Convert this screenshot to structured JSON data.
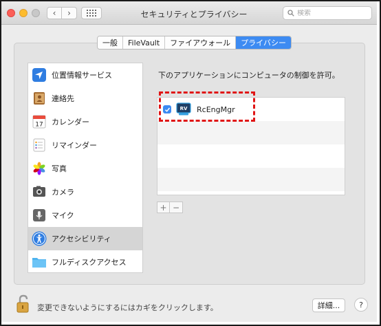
{
  "window": {
    "title": "セキュリティとプライバシー",
    "search_placeholder": "検索"
  },
  "tabs": [
    {
      "label": "一般",
      "active": false
    },
    {
      "label": "FileVault",
      "active": false
    },
    {
      "label": "ファイアウォール",
      "active": false
    },
    {
      "label": "プライバシー",
      "active": true
    }
  ],
  "sidebar": {
    "items": [
      {
        "label": "位置情報サービス",
        "icon": "location-arrow-icon"
      },
      {
        "label": "連絡先",
        "icon": "contacts-book-icon"
      },
      {
        "label": "カレンダー",
        "icon": "calendar-icon",
        "date": "17"
      },
      {
        "label": "リマインダー",
        "icon": "reminders-icon"
      },
      {
        "label": "写真",
        "icon": "photos-icon"
      },
      {
        "label": "カメラ",
        "icon": "camera-icon"
      },
      {
        "label": "マイク",
        "icon": "microphone-icon"
      },
      {
        "label": "アクセシビリティ",
        "icon": "accessibility-icon",
        "selected": true
      },
      {
        "label": "フルディスクアクセス",
        "icon": "folder-icon"
      }
    ]
  },
  "main": {
    "description": "下のアプリケーションにコンピュータの制御を許可。",
    "apps": [
      {
        "name": "RcEngMgr",
        "icon_text": "RV",
        "checked": true
      }
    ],
    "add_label": "+",
    "remove_label": "−"
  },
  "footer": {
    "lock_text": "変更できないようにするにはカギをクリックします。",
    "details_label": "詳細...",
    "help_label": "?"
  },
  "colors": {
    "accent": "#3d8bf2",
    "highlight": "#e01616"
  }
}
